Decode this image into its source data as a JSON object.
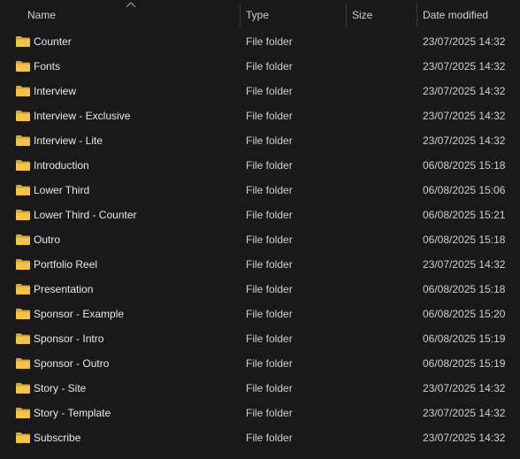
{
  "columns": {
    "name": "Name",
    "type": "Type",
    "size": "Size",
    "date": "Date modified"
  },
  "sort": {
    "column": "name",
    "direction": "ascending",
    "icon": "sort-up-arrow-icon"
  },
  "folder_icon": {
    "name": "folder-icon",
    "color": "#f3c34c",
    "shade": "#d9a532"
  },
  "files": [
    {
      "name": "Counter",
      "type": "File folder",
      "size": "",
      "date": "23/07/2025 14:32"
    },
    {
      "name": "Fonts",
      "type": "File folder",
      "size": "",
      "date": "23/07/2025 14:32"
    },
    {
      "name": "Interview",
      "type": "File folder",
      "size": "",
      "date": "23/07/2025 14:32"
    },
    {
      "name": "Interview - Exclusive",
      "type": "File folder",
      "size": "",
      "date": "23/07/2025 14:32"
    },
    {
      "name": "Interview - Lite",
      "type": "File folder",
      "size": "",
      "date": "23/07/2025 14:32"
    },
    {
      "name": "Introduction",
      "type": "File folder",
      "size": "",
      "date": "06/08/2025 15:18"
    },
    {
      "name": "Lower Third",
      "type": "File folder",
      "size": "",
      "date": "06/08/2025 15:06"
    },
    {
      "name": "Lower Third - Counter",
      "type": "File folder",
      "size": "",
      "date": "06/08/2025 15:21"
    },
    {
      "name": "Outro",
      "type": "File folder",
      "size": "",
      "date": "06/08/2025 15:18"
    },
    {
      "name": "Portfolio Reel",
      "type": "File folder",
      "size": "",
      "date": "23/07/2025 14:32"
    },
    {
      "name": "Presentation",
      "type": "File folder",
      "size": "",
      "date": "06/08/2025 15:18"
    },
    {
      "name": "Sponsor - Example",
      "type": "File folder",
      "size": "",
      "date": "06/08/2025 15:20"
    },
    {
      "name": "Sponsor - Intro",
      "type": "File folder",
      "size": "",
      "date": "06/08/2025 15:19"
    },
    {
      "name": "Sponsor - Outro",
      "type": "File folder",
      "size": "",
      "date": "06/08/2025 15:19"
    },
    {
      "name": "Story - Site",
      "type": "File folder",
      "size": "",
      "date": "23/07/2025 14:32"
    },
    {
      "name": "Story - Template",
      "type": "File folder",
      "size": "",
      "date": "23/07/2025 14:32"
    },
    {
      "name": "Subscribe",
      "type": "File folder",
      "size": "",
      "date": "23/07/2025 14:32"
    }
  ]
}
